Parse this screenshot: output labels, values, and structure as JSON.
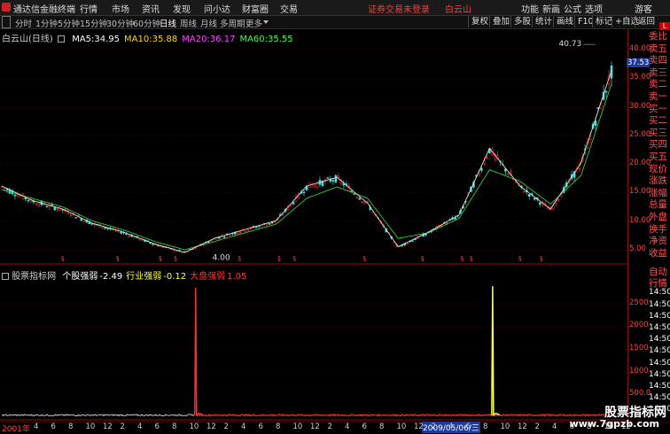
{
  "app": {
    "title": "通达信金融终端"
  },
  "menu": {
    "items": [
      "行情",
      "市场",
      "资讯",
      "发现",
      "问小达",
      "财富圈",
      "交易"
    ],
    "warning": "证券交易未登录",
    "stock": "白云山",
    "right": [
      "功能",
      "新画",
      "公式",
      "选项"
    ],
    "guest": "游客"
  },
  "periodbar": {
    "periods": [
      "分时",
      "1分钟",
      "5分钟",
      "15分钟",
      "30分钟",
      "60分钟",
      "日线",
      "周线",
      "月线",
      "多周期",
      "更多"
    ],
    "active": "日线",
    "tools": [
      "复权",
      "叠加",
      "多股",
      "统计",
      "画线",
      "F10",
      "标记",
      "+自选",
      "返回"
    ]
  },
  "kchart": {
    "title": "白云山(日线)",
    "ma": [
      {
        "label": "MA5:",
        "value": "34.95",
        "color": "#ffffff"
      },
      {
        "label": "MA10:",
        "value": "35.88",
        "color": "#ffd700"
      },
      {
        "label": "MA20:",
        "value": "36.17",
        "color": "#ff44ff"
      },
      {
        "label": "MA60:",
        "value": "35.55",
        "color": "#44ff44"
      }
    ],
    "high_label": "40.73",
    "low_label": "4.00",
    "current_price": "37.53",
    "y_ticks": [
      "40.00",
      "35.00",
      "30.00",
      "25.00",
      "20.00",
      "15.00",
      "10.00",
      "5.00"
    ]
  },
  "indicator": {
    "title": "股票指标网",
    "items": [
      {
        "label": "个股强弱",
        "value": "-2.49",
        "color": "#ffffff"
      },
      {
        "label": "行业强弱",
        "value": "-0.12",
        "color": "#ffff44"
      },
      {
        "label": "大盘强弱",
        "value": "1.05",
        "color": "#ff3333"
      }
    ],
    "y_ticks": [
      "2500",
      "2000",
      "1500",
      "1000",
      "500.0"
    ]
  },
  "sidepanel": {
    "labels": [
      "委比",
      "卖五",
      "卖四",
      "卖三",
      "卖二",
      "卖一",
      "买一",
      "买二",
      "买三",
      "买四",
      "买五",
      "现价",
      "涨跌",
      "涨幅",
      "总量",
      "外盘",
      "换手",
      "净资",
      "收益",
      "自动",
      "行情",
      "14:50",
      "14:50",
      "14:50",
      "14:50",
      "14:50",
      "14:50",
      "14:50",
      "14:50",
      "14:50",
      "14:50",
      "14:50"
    ],
    "badge": "L"
  },
  "footer": {
    "year_label": "2001年",
    "date_highlight": "2009/05/06/三",
    "months": [
      "4",
      "6",
      "8",
      "10",
      "12",
      "2",
      "4",
      "6",
      "8",
      "10",
      "12",
      "2",
      "4",
      "6",
      "8",
      "10",
      "12",
      "2",
      "4",
      "6",
      "8",
      "10",
      "12",
      "2",
      "4",
      "6",
      "8",
      "10",
      "12",
      "2",
      "4",
      "6",
      "8",
      "10",
      "12"
    ]
  },
  "watermark": {
    "line1": "股票指标网",
    "line2": "www.7gpzb.com"
  },
  "chart_data": {
    "type": "line",
    "title": "白云山(日线)",
    "ylim": [
      3,
      42
    ],
    "y_ticks": [
      5,
      10,
      15,
      20,
      25,
      30,
      35,
      40
    ],
    "x": [
      0,
      5,
      10,
      15,
      20,
      25,
      30,
      35,
      40,
      45,
      50,
      55,
      60,
      65,
      70,
      75,
      80,
      85,
      90,
      95,
      100
    ],
    "series": [
      {
        "name": "MA5",
        "values": [
          16.0,
          13.5,
          12.0,
          9.5,
          8.0,
          6.0,
          4.5,
          7.0,
          8.5,
          10.0,
          16.0,
          17.5,
          13.0,
          5.5,
          8.0,
          11.0,
          22.5,
          16.0,
          12.0,
          20.0,
          36.0
        ]
      },
      {
        "name": "MA60",
        "values": [
          15.5,
          14.0,
          12.5,
          10.0,
          8.5,
          6.5,
          5.0,
          6.5,
          8.0,
          9.5,
          14.0,
          16.0,
          14.0,
          7.0,
          8.0,
          10.5,
          19.0,
          17.0,
          13.0,
          18.0,
          34.0
        ]
      }
    ],
    "indicator": {
      "ylim": [
        0,
        3000
      ],
      "spikes": [
        {
          "x": 31.8,
          "value": 2850,
          "series": "大盘强弱"
        },
        {
          "x": 80.5,
          "value": 2880,
          "series": "行业强弱"
        }
      ]
    }
  }
}
